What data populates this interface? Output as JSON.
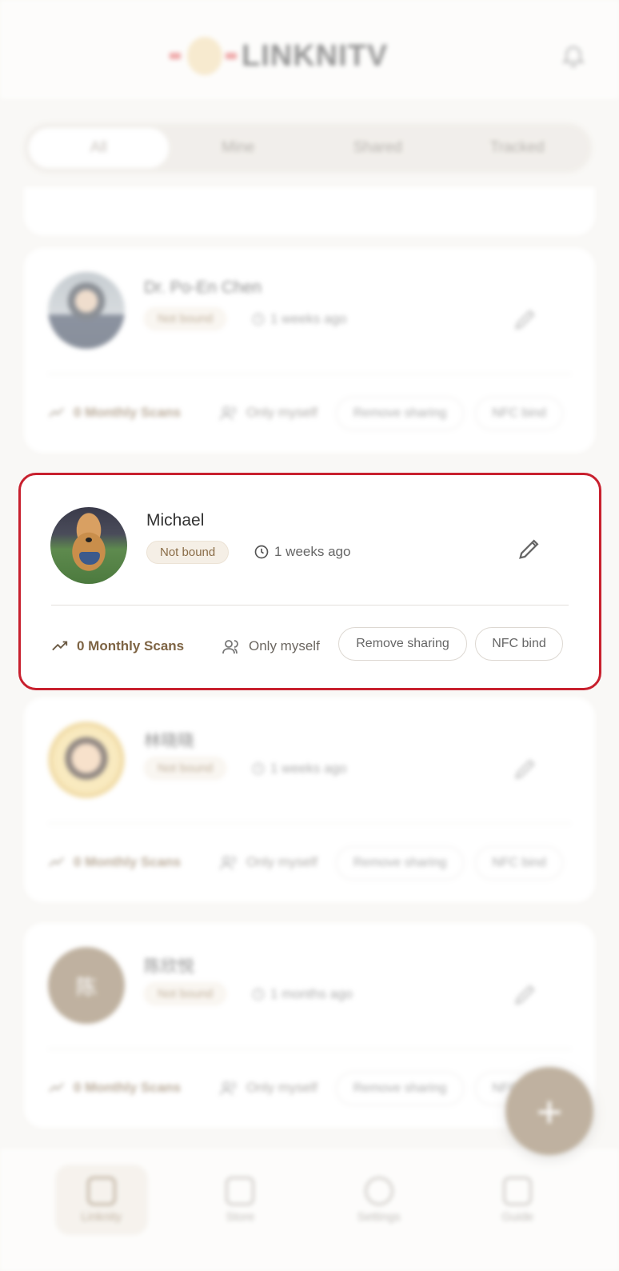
{
  "app": {
    "logo_text": "LINKNITV"
  },
  "tabs": [
    {
      "label": "All",
      "active": true
    },
    {
      "label": "Mine",
      "active": false
    },
    {
      "label": "Shared",
      "active": false
    },
    {
      "label": "Tracked",
      "active": false
    }
  ],
  "cards": [
    {
      "name": "Dr. Po-En Chen",
      "badge": "Not bound",
      "time": "1 weeks ago",
      "scans": "0 Monthly Scans",
      "sharing": "Only myself",
      "remove_label": "Remove sharing",
      "nfc_label": "NFC bind",
      "avatar": "photo"
    },
    {
      "name": "Michael",
      "badge": "Not bound",
      "time": "1 weeks ago",
      "scans": "0 Monthly Scans",
      "sharing": "Only myself",
      "remove_label": "Remove sharing",
      "nfc_label": "NFC bind",
      "avatar": "dog-photo"
    },
    {
      "name": "林晓晓",
      "badge": "Not bound",
      "time": "1 weeks ago",
      "scans": "0 Monthly Scans",
      "sharing": "Only myself",
      "remove_label": "Remove sharing",
      "nfc_label": "NFC bind",
      "avatar": "photo"
    },
    {
      "name": "陈欣悦",
      "badge": "Not bound",
      "time": "1 months ago",
      "scans": "0 Monthly Scans",
      "sharing": "Only myself",
      "remove_label": "Remove sharing",
      "nfc_label": "NFC bind",
      "avatar": "initial",
      "initial": "陈"
    }
  ],
  "fab": {
    "label": "+"
  },
  "bottom_nav": [
    {
      "label": "Linknity",
      "icon": "home-icon",
      "active": true
    },
    {
      "label": "Store",
      "icon": "store-icon",
      "active": false
    },
    {
      "label": "Settings",
      "icon": "settings-icon",
      "active": false
    },
    {
      "label": "Guide",
      "icon": "guide-icon",
      "active": false
    }
  ],
  "colors": {
    "accent": "#8b7252",
    "highlight_border": "#c8202e",
    "background": "#f4f2ee"
  }
}
